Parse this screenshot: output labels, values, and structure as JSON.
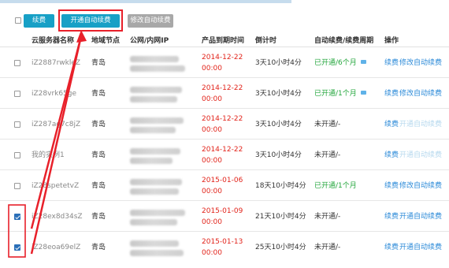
{
  "toolbar": {
    "renew_label": "续费",
    "enable_auto_renew_label": "开通自动续费",
    "modify_auto_renew_label": "修改自动续费"
  },
  "columns": {
    "name": "云服务器名称",
    "region": "地域节点",
    "ip": "公网/内网IP",
    "expire": "产品到期时间",
    "countdown": "倒计时",
    "auto_renew": "自动续费/续费周期",
    "ops": "操作"
  },
  "rows": [
    {
      "name": "iZ2887rwkleZ",
      "region": "青岛",
      "expire_date": "2014-12-22",
      "expire_time": "00:00",
      "countdown": "3天10小时4分",
      "auto_renew": "已开通/6个月",
      "auto_on": true,
      "renew": "续费",
      "modify": "修改自动续费",
      "checked": false
    },
    {
      "name": "iZ28vrk65ge",
      "region": "青岛",
      "expire_date": "2014-12-22",
      "expire_time": "00:00",
      "countdown": "3天10小时4分",
      "auto_renew": "已开通/1个月",
      "auto_on": true,
      "renew": "续费",
      "modify": "修改自动续费",
      "checked": false
    },
    {
      "name": "iZ287ag7c8jZ",
      "region": "青岛",
      "expire_date": "2014-12-22",
      "expire_time": "00:00",
      "countdown": "3天10小时4分",
      "auto_renew": "未开通/-",
      "auto_on": false,
      "renew": "续费",
      "modify": "开通自动续费",
      "checked": false
    },
    {
      "name": "我的实例1",
      "region": "青岛",
      "expire_date": "2014-12-22",
      "expire_time": "00:00",
      "countdown": "3天10小时4分",
      "auto_renew": "未开通/-",
      "auto_on": false,
      "renew": "续费",
      "modify": "开通自动续费",
      "checked": false
    },
    {
      "name": "iZ28spetetvZ",
      "region": "青岛",
      "expire_date": "2015-01-06",
      "expire_time": "00:00",
      "countdown": "18天10小时4分",
      "auto_renew": "已开通/1个月",
      "auto_on": true,
      "renew": "续费",
      "modify": "修改自动续费",
      "checked": false
    },
    {
      "name": "iZ28ex8d34sZ",
      "region": "青岛",
      "expire_date": "2015-01-09",
      "expire_time": "00:00",
      "countdown": "21天10小时4分",
      "auto_renew": "未开通/-",
      "auto_on": false,
      "renew": "续费",
      "modify": "开通自动续费",
      "checked": true
    },
    {
      "name": "iZ28eoa69elZ",
      "region": "青岛",
      "expire_date": "2015-01-13",
      "expire_time": "00:00",
      "countdown": "25天10小时4分",
      "auto_renew": "未开通/-",
      "auto_on": false,
      "renew": "续费",
      "modify": "开通自动续费",
      "checked": true
    }
  ],
  "colors": {
    "primary_button": "#17a0c6",
    "disabled_button": "#a8a8a8",
    "annotation": "#e8202a",
    "expire_red": "#e2231a",
    "enabled_green": "#23a63c",
    "link_blue": "#2b8ad8"
  }
}
